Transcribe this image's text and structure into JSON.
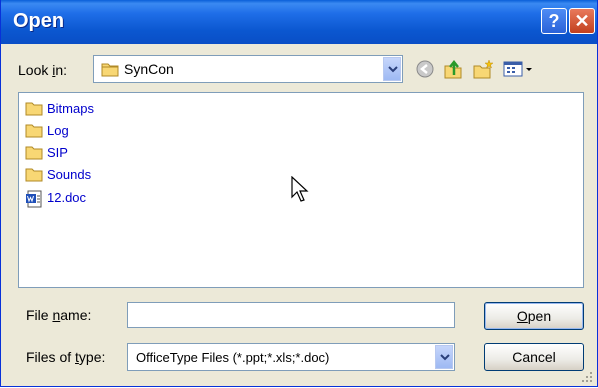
{
  "window": {
    "title": "Open"
  },
  "titlebar": {
    "help_icon": "?",
    "close_icon": "✕"
  },
  "lookin": {
    "label_prefix": "Look ",
    "label_underlined": "i",
    "label_suffix": "n:",
    "value": "SynCon"
  },
  "toolbar": {
    "icons": [
      "back-icon",
      "up-folder-icon",
      "new-folder-icon",
      "views-menu-icon"
    ]
  },
  "files": [
    {
      "name": "Bitmaps",
      "type": "folder"
    },
    {
      "name": "Log",
      "type": "folder"
    },
    {
      "name": "SIP",
      "type": "folder"
    },
    {
      "name": "Sounds",
      "type": "folder"
    },
    {
      "name": "12.doc",
      "type": "word-document"
    }
  ],
  "filename": {
    "label_prefix": "File ",
    "label_underlined": "n",
    "label_suffix": "ame:",
    "value": ""
  },
  "filetype": {
    "label_prefix": "Files of ",
    "label_underlined": "t",
    "label_suffix": "ype:",
    "value": "OfficeType Files (*.ppt;*.xls;*.doc)"
  },
  "buttons": {
    "open_underlined": "O",
    "open_rest": "pen",
    "cancel": "Cancel"
  },
  "colors": {
    "titlebar": "#0b57d0",
    "dialog_bg": "#ece9d8",
    "file_text": "#0000cc"
  }
}
